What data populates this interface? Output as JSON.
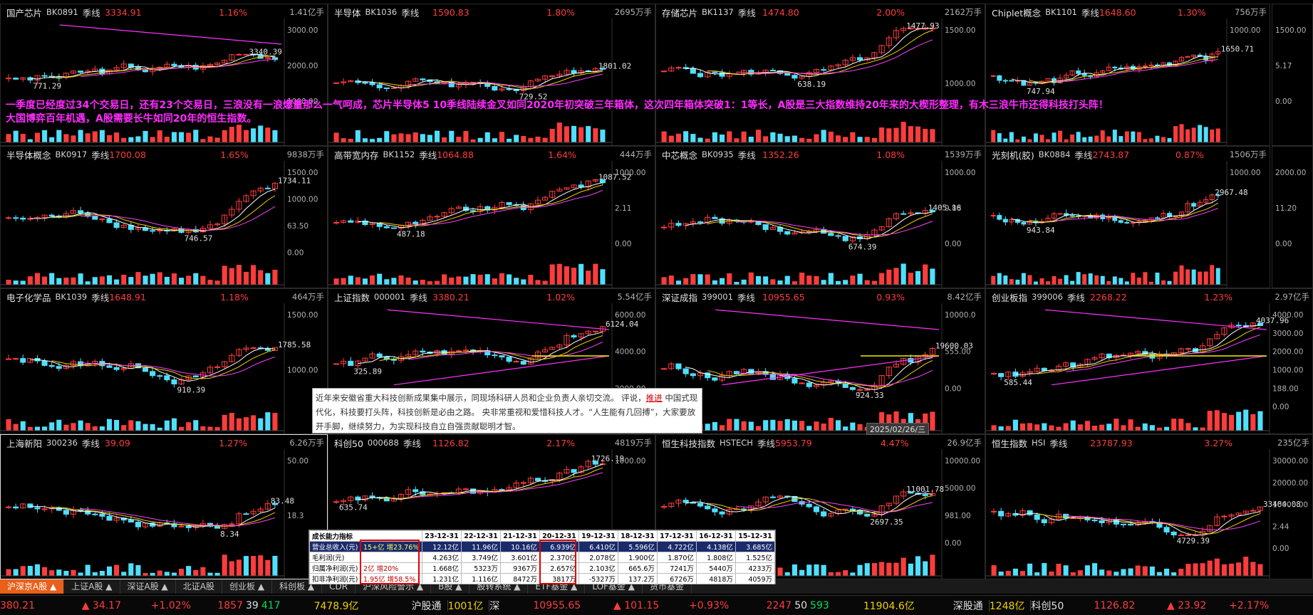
{
  "panels": [
    {
      "name": "国产芯片",
      "code": "BK0891",
      "period": "季线",
      "price": "3334.91",
      "change": "1.16%",
      "volume": "1.41亿手",
      "hi": "3340.39",
      "lo": "771.29",
      "yticks": [
        "3000.00",
        "2000.00",
        "1000.00"
      ],
      "voltick": "0.00",
      "selected": false
    },
    {
      "name": "半导体",
      "code": "BK1036",
      "period": "季线",
      "price": "1590.83",
      "change": "1.80%",
      "volume": "2695万手",
      "hi": "1801.02",
      "lo": "729.52",
      "yticks": [],
      "voltick": "",
      "selected": false
    },
    {
      "name": "存储芯片",
      "code": "BK1137",
      "period": "季线",
      "price": "1474.80",
      "change": "2.00%",
      "volume": "2162万手",
      "hi": "1477.93",
      "lo": "638.19",
      "yticks": [
        "1500.00",
        "1000.00"
      ],
      "voltick": "0.00",
      "selected": false
    },
    {
      "name": "Chiplet概念",
      "code": "BK1101",
      "period": "季线",
      "price": "1648.60",
      "change": "1.30%",
      "volume": "756万手",
      "hi": "1650.71",
      "lo": "747.94",
      "yticks": [
        "1000.00"
      ],
      "voltick": "0.00",
      "selected": false
    },
    {
      "name": "",
      "code": "",
      "period": "",
      "price": "",
      "change": "",
      "volume": "",
      "hi": "",
      "lo": "",
      "yticks": [
        "1500.00",
        "5.17",
        "0.00"
      ],
      "voltick": "",
      "selected": false
    },
    {
      "name": "半导体概念",
      "code": "BK0917",
      "period": "季线",
      "price": "1700.08",
      "change": "1.65%",
      "volume": "9838万手",
      "hi": "1734.11",
      "lo": "746.57",
      "yticks": [
        "1500.00",
        "1000.00",
        "63.50",
        "0.00"
      ],
      "voltick": "",
      "selected": false
    },
    {
      "name": "高带宽内存",
      "code": "BK1152",
      "period": "季线",
      "price": "1064.88",
      "change": "1.64%",
      "volume": "444万手",
      "hi": "1087.52",
      "lo": "487.18",
      "yticks": [
        "1000.00",
        "2.11",
        "0.00"
      ],
      "voltick": "",
      "selected": false
    },
    {
      "name": "中芯概念",
      "code": "BK0935",
      "period": "季线",
      "price": "1352.26",
      "change": "1.08%",
      "volume": "1539万手",
      "hi": "1405.16",
      "lo": "674.39",
      "yticks": [
        "1000.00",
        "9.88",
        "0.00"
      ],
      "voltick": "",
      "selected": false
    },
    {
      "name": "光刻机(胶)",
      "code": "BK0884",
      "period": "季线",
      "price": "2743.87",
      "change": "0.87%",
      "volume": "1506万手",
      "hi": "2967.48",
      "lo": "943.84",
      "yticks": [
        "1000.00"
      ],
      "voltick": "",
      "selected": false
    },
    {
      "name": "",
      "code": "",
      "period": "",
      "price": "",
      "change": "",
      "volume": "",
      "hi": "",
      "lo": "",
      "yticks": [
        "2000.00",
        "11.20",
        "0.00"
      ],
      "voltick": "",
      "selected": false
    },
    {
      "name": "电子化学品",
      "code": "BK1039",
      "period": "季线",
      "price": "1648.91",
      "change": "1.18%",
      "volume": "464万手",
      "hi": "1785.58",
      "lo": "910.39",
      "yticks": [
        "1500.00",
        "1000.00"
      ],
      "voltick": "",
      "selected": false
    },
    {
      "name": "上证指数",
      "code": "000001",
      "period": "季线",
      "price": "3380.21",
      "change": "1.02%",
      "volume": "5.54亿手",
      "hi": "6124.04",
      "lo": "325.89",
      "yticks": [
        "6000.00",
        "4000.00",
        "2000.00"
      ],
      "voltick": "",
      "selected": false
    },
    {
      "name": "深证成指",
      "code": "399001",
      "period": "季线",
      "price": "10955.65",
      "change": "0.93%",
      "volume": "8.42亿手",
      "hi": "19600.03",
      "lo": "924.33",
      "yticks": [
        "10000.0",
        "555.00",
        "0.00"
      ],
      "voltick": "",
      "selected": false
    },
    {
      "name": "创业板指",
      "code": "399006",
      "period": "季线",
      "price": "2268.22",
      "change": "1.23%",
      "volume": "2.97亿手",
      "hi": "4037.96",
      "lo": "585.44",
      "yticks": [
        "4000.00",
        "3000.00",
        "2000.00",
        "1000.00",
        "188.00",
        "0.00"
      ],
      "voltick": "",
      "selected": false
    },
    {
      "name": "上海新阳",
      "code": "300236",
      "period": "季线",
      "price": "39.09",
      "change": "1.27%",
      "volume": "6.26万手",
      "hi": "83.48",
      "lo": "8.34",
      "yticks": [
        "50.00",
        "18.3"
      ],
      "voltick": "",
      "selected": true
    },
    {
      "name": "科创50",
      "code": "000688",
      "period": "季线",
      "price": "1126.82",
      "change": "2.17%",
      "volume": "4819万手",
      "hi": "1726.19",
      "lo": "635.74",
      "yticks": [
        "1000.00"
      ],
      "voltick": "",
      "selected": false
    },
    {
      "name": "恒生科技指数",
      "code": "HSTECH",
      "period": "季线",
      "price": "5953.79",
      "change": "4.47%",
      "volume": "26.9亿手",
      "hi": "11001.78",
      "lo": "2697.35",
      "yticks": [
        "10000.00",
        "5000.00",
        "981.00",
        "0.00"
      ],
      "voltick": "",
      "selected": false
    },
    {
      "name": "恒生指数",
      "code": "HSI",
      "period": "季线",
      "price": "23787.93",
      "change": "3.27%",
      "volume": "235亿手",
      "hi": "33484.08",
      "lo": "4729.39",
      "yticks": [
        "30000.00",
        "20000.00",
        "10000.00",
        "2.44",
        "0.00"
      ],
      "voltick": "",
      "selected": false
    }
  ],
  "annotation": {
    "line1": "一季度已经度过34个交易日，还有23个交易日，三浪没有一浪爆量那么一气呵成，芯片半导体5 10季线陆续金叉如同2020年初突破三年箱体，这次四年箱体突破1：1等长，A股是三大指数维持20年来的大楔形整理，有木三浪牛市还得科技打头阵！",
    "line2": "大国博弈百年机遇，A股需要长牛如同20年的恒生指数。"
  },
  "news": {
    "text_a": "近年来安徽省重大科技创新成果集中展示，同现场科研人员和企业负责人亲切交流。",
    "text_b": "评说，",
    "text_c": "推进",
    "text_d": "中国式现代化，科技要打头阵，科技创新是必由之路。",
    "text_e": "央非常重视和爱惜科技人才。“人生能有几回搏”，大家要放开手脚，继续努力，为实现科技自立自强贡献聪明才智。"
  },
  "date_badge": "2025/02/26/三",
  "financial": {
    "header": [
      "成长能力指标",
      "23-12-31",
      "22-12-31",
      "21-12-31",
      "20-12-31",
      "19-12-31",
      "18-12-31",
      "17-12-31",
      "16-12-31",
      "15-12-31"
    ],
    "rows": [
      {
        "label": "营业总收入(元)",
        "note": "15+亿  增23.76%",
        "values": [
          "12.12亿",
          "11.96亿",
          "10.16亿",
          "6.939亿",
          "6.410亿",
          "5.596亿",
          "4.722亿",
          "4.138亿",
          "3.685亿"
        ]
      },
      {
        "label": "毛利润(元)",
        "note": "",
        "values": [
          "4.263亿",
          "3.749亿",
          "3.601亿",
          "2.370亿",
          "2.078亿",
          "1.900亿",
          "1.870亿",
          "1.808亿",
          "1.525亿"
        ]
      },
      {
        "label": "归属净利润(元)",
        "note": "2亿   增20%",
        "values": [
          "1.668亿",
          "5323万",
          "9367万",
          "2.657亿",
          "2.103亿",
          "665.6万",
          "7241万",
          "5440万",
          "4233万"
        ]
      },
      {
        "label": "扣非净利润(元)",
        "note": "1.95亿  增58.5%",
        "values": [
          "1.231亿",
          "1.116亿",
          "8472万",
          "3817万",
          "-5327万",
          "137.2万",
          "6726万",
          "4818万",
          "4059万"
        ]
      }
    ]
  },
  "tabs": [
    {
      "label": "沪深京A股 ▲",
      "active": true
    },
    {
      "label": "上证A股 ▲",
      "active": false
    },
    {
      "label": "深证A股 ▲",
      "active": false
    },
    {
      "label": "北证A股",
      "active": false
    },
    {
      "label": "创业板 ▲",
      "active": false
    },
    {
      "label": "科创板 ▲",
      "active": false
    },
    {
      "label": "CDR",
      "active": false
    },
    {
      "label": "沪深风险警示 ▲",
      "active": false
    },
    {
      "label": "B股 ▲",
      "active": false
    },
    {
      "label": "股转系统 ▲",
      "active": false
    },
    {
      "label": "ETF基金 ▲",
      "active": false
    },
    {
      "label": "LOF基金 ▲",
      "active": false
    },
    {
      "label": "货币基金",
      "active": false
    }
  ],
  "status": {
    "sh_price": "380.21",
    "sh_chg": "▲ 34.17",
    "sh_pct": "+1.02%",
    "sh_up": "1857",
    "sh_flat": "39",
    "sh_down": "417",
    "sh_amt": "7478.9亿",
    "hgt_label": "沪股通",
    "hgt_val": "1001亿",
    "sz_label": "深",
    "sz_price": "10955.65",
    "sz_chg": "▲ 101.15",
    "sz_pct": "+0.93%",
    "sz_up": "2247",
    "sz_flat": "50",
    "sz_down": "593",
    "sz_amt": "11904.6亿",
    "sgt_label": "深股通",
    "sgt_val": "1248亿",
    "kc_label": "科创50",
    "kc_price": "1126.82",
    "kc_chg": "▲ 23.92",
    "kc_pct": "+2.17%"
  },
  "colors": {
    "up": "#ff3c3c",
    "down": "#4fe0ff",
    "accent": "#e8601a",
    "magenta": "#ff2bff"
  }
}
